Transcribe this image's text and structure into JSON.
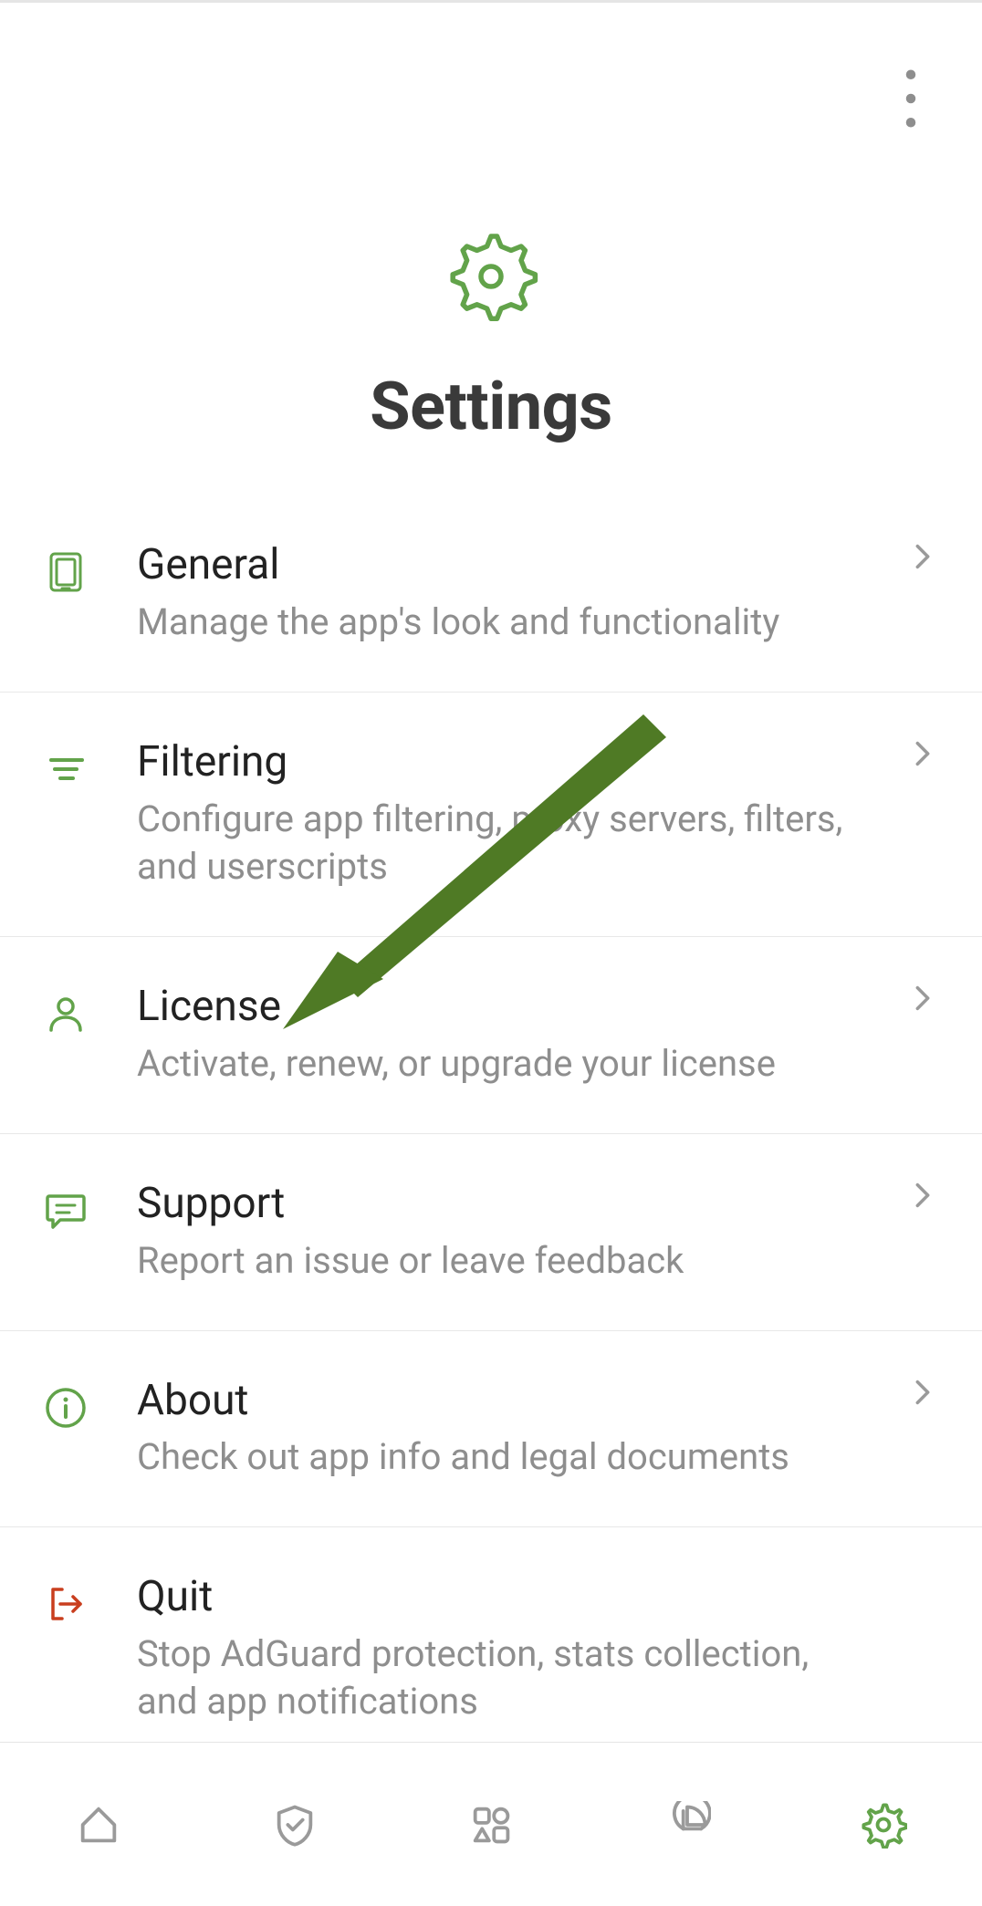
{
  "header": {
    "title": "Settings"
  },
  "items": [
    {
      "iconColor": "#62a34a",
      "quit": false,
      "title": "General",
      "subtitle": "Manage the app's look and functionality"
    },
    {
      "iconColor": "#62a34a",
      "quit": false,
      "title": "Filtering",
      "subtitle": "Configure app filtering, proxy servers, filters, and userscripts"
    },
    {
      "iconColor": "#62a34a",
      "quit": false,
      "title": "License",
      "subtitle": "Activate, renew, or upgrade your license"
    },
    {
      "iconColor": "#62a34a",
      "quit": false,
      "title": "Support",
      "subtitle": "Report an issue or leave feedback"
    },
    {
      "iconColor": "#62a34a",
      "quit": false,
      "title": "About",
      "subtitle": "Check out app info and legal documents"
    },
    {
      "iconColor": "#c93e1e",
      "quit": true,
      "title": "Quit",
      "subtitle": "Stop AdGuard protection, stats collection, and app notifications"
    }
  ],
  "bottomNav": {
    "items": [
      {
        "name": "home",
        "active": false
      },
      {
        "name": "shield",
        "active": false
      },
      {
        "name": "apps",
        "active": false
      },
      {
        "name": "stats",
        "active": false
      },
      {
        "name": "settings",
        "active": true
      }
    ]
  },
  "colors": {
    "accent": "#62a34a",
    "quit": "#c93e1e",
    "text": "#3a3a3a",
    "subtext": "#8e8e8e",
    "chevron": "#9a9a9a",
    "navInactive": "#9a9a9a",
    "arrow": "#4f7a25"
  }
}
